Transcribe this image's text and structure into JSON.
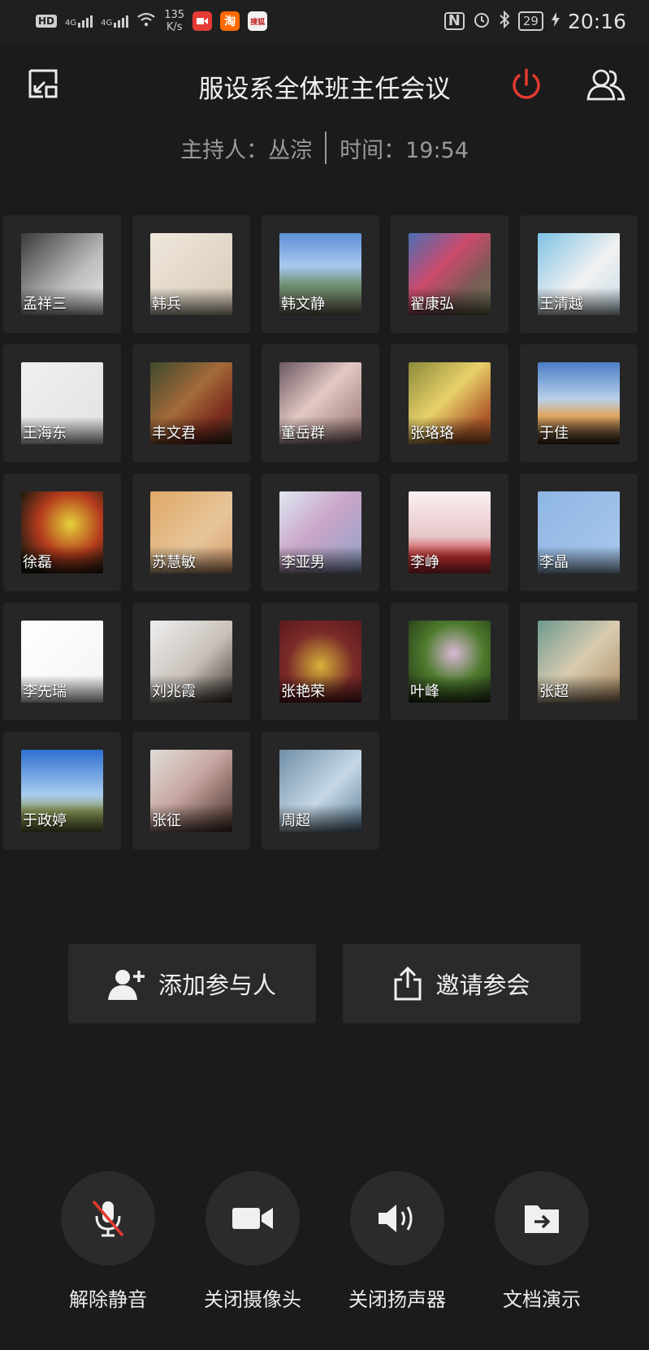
{
  "status_bar": {
    "hd": "HD",
    "sig1": "4G",
    "sig2": "4G",
    "speed_value": "135",
    "speed_unit": "K/s",
    "app_taobao": "淘",
    "app_sohu": "搜狐",
    "battery": "29",
    "time": "20:16"
  },
  "header": {
    "title": "服设系全体班主任会议",
    "host_label": "主持人：丛淙",
    "time_label": "时间：19:54",
    "accent": "#e23b2e"
  },
  "participants": [
    {
      "name": "孟祥三",
      "bg": "linear-gradient(135deg,#3a3a3a,#bdbdbd 60%,#eaeaea)"
    },
    {
      "name": "韩兵",
      "bg": "linear-gradient(135deg,#efe7dc,#d8cbb8)"
    },
    {
      "name": "韩文静",
      "bg": "linear-gradient(to bottom,#5d8fd6 0%,#a9c8ee 40%,#6b8a6a 65%,#7c7a66 100%)"
    },
    {
      "name": "翟康弘",
      "bg": "linear-gradient(135deg,#4c6fb2,#cc4a6e 40%,#7b5b55 70%,#6f7a58)"
    },
    {
      "name": "王清越",
      "bg": "linear-gradient(135deg,#7ec3e6,#f1f1f1 55%,#c9dde8)"
    },
    {
      "name": "王海东",
      "bg": "linear-gradient(135deg,#f0f0f0,#e2e2e2)"
    },
    {
      "name": "丰文君",
      "bg": "linear-gradient(135deg,#3d4a2c,#a56a3a 45%,#7a2c1e 75%,#3a3020)"
    },
    {
      "name": "董岳群",
      "bg": "linear-gradient(135deg,#6b5863,#e3c8c3 45%,#8f6e6c)"
    },
    {
      "name": "张珞珞",
      "bg": "linear-gradient(135deg,#8c8a3a,#e8d16a 45%,#b05a2c 80%)"
    },
    {
      "name": "于佳",
      "bg": "linear-gradient(to bottom,#4b7ec6,#b9d0ea 45%,#e0a860 65%,#3a2a22)"
    },
    {
      "name": "徐磊",
      "bg": "radial-gradient(circle at 60% 40%,#e5d23a,#b43b1d 45%,#1a1a10 85%)"
    },
    {
      "name": "苏慧敏",
      "bg": "linear-gradient(135deg,#e0a868,#e6c59a 60%,#d89a6a)"
    },
    {
      "name": "李亚男",
      "bg": "linear-gradient(135deg,#dfe6f2,#c9a6c8 45%,#8fa2c8)"
    },
    {
      "name": "李峥",
      "bg": "linear-gradient(to bottom,#fbf0f1,#e6c5c8 55%,#c43030 80%)"
    },
    {
      "name": "李晶",
      "bg": "linear-gradient(135deg,#8fb6e4,#a9c8ec)"
    },
    {
      "name": "李先瑞",
      "bg": "linear-gradient(135deg,#ffffff,#f4f4f4)"
    },
    {
      "name": "刘兆霞",
      "bg": "linear-gradient(135deg,#efefef,#c8c0b8 55%,#3d3530)"
    },
    {
      "name": "张艳荣",
      "bg": "radial-gradient(circle at 50% 55%,#d6b23a,#7a2a28 55%,#5d1a1e)"
    },
    {
      "name": "叶峰",
      "bg": "radial-gradient(circle at 55% 40%,#d9b8d6,#4d7a2c 45%,#1e2c16)"
    },
    {
      "name": "张超",
      "bg": "linear-gradient(135deg,#6f9a8f,#d8cbb0 50%,#a98a60)"
    },
    {
      "name": "于政婷",
      "bg": "linear-gradient(to bottom,#2f6fd0,#a9cdf0 55%,#8c9a5a 75%,#6a7a3a)"
    },
    {
      "name": "张征",
      "bg": "linear-gradient(135deg,#e0dcd8,#c8a8a2 45%,#4a3028)"
    },
    {
      "name": "周超",
      "bg": "linear-gradient(135deg,#6f8ea6,#c6d8e6 55%,#5e7e96)"
    }
  ],
  "actions": {
    "add_participant": "添加参与人",
    "invite": "邀请参会"
  },
  "controls": {
    "unmute": "解除静音",
    "camera_off": "关闭摄像头",
    "speaker_off": "关闭扬声器",
    "doc_present": "文档演示"
  }
}
